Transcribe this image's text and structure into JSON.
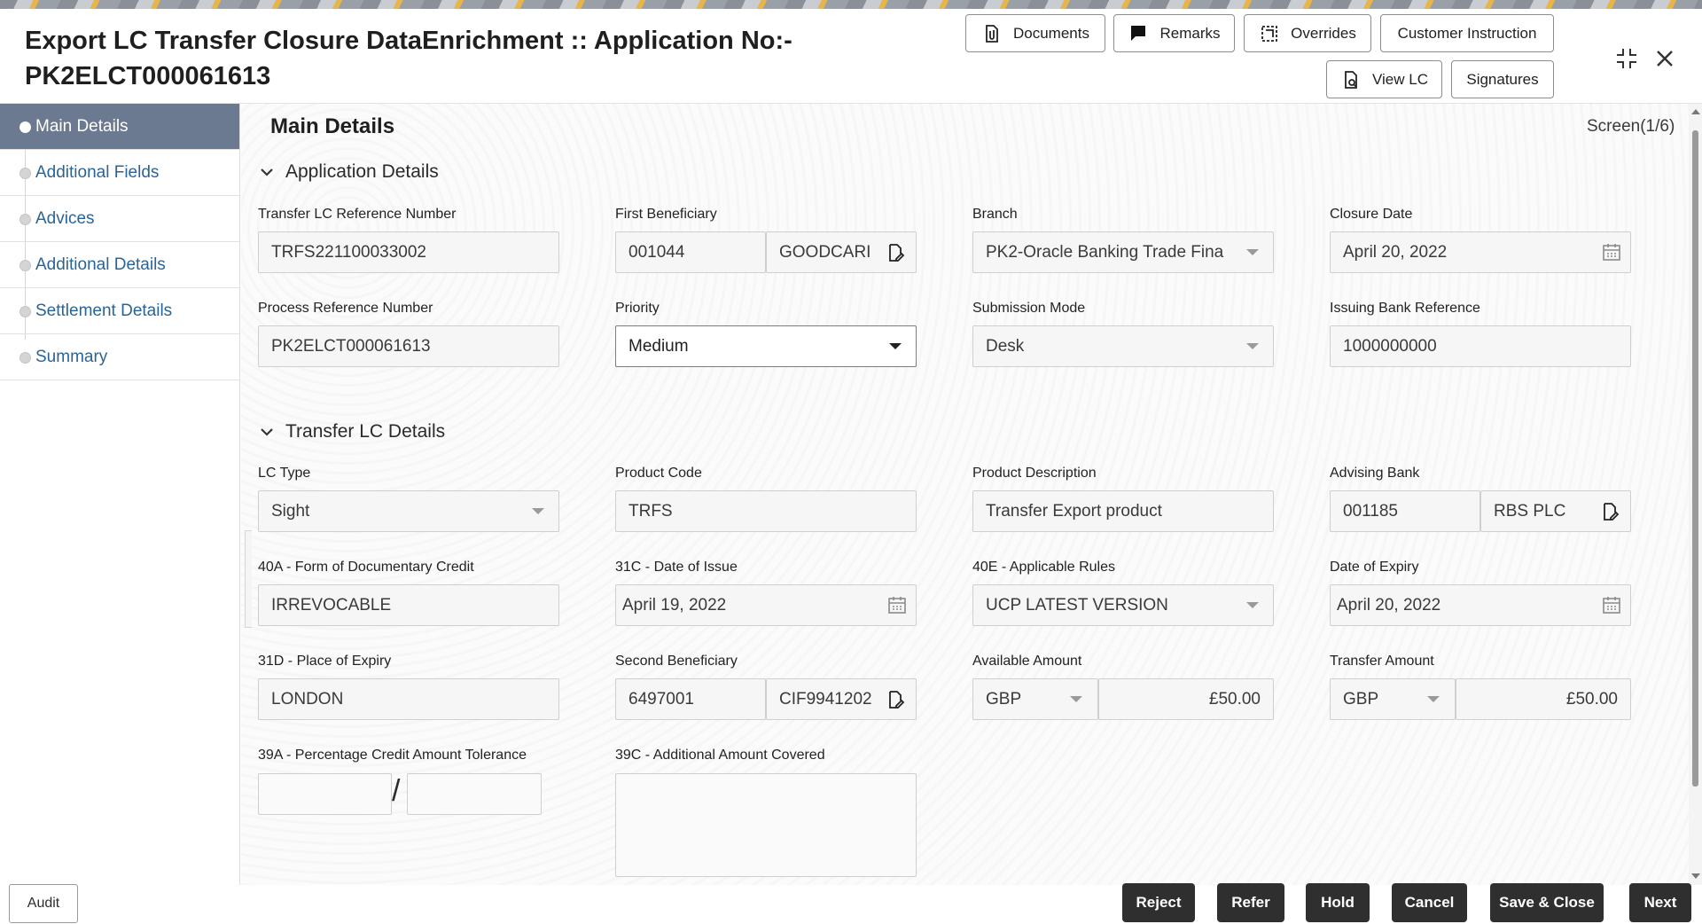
{
  "header": {
    "title": "Export LC Transfer Closure DataEnrichment :: Application No:- PK2ELCT000061613",
    "buttons": {
      "documents": "Documents",
      "remarks": "Remarks",
      "overrides": "Overrides",
      "customer_instruction": "Customer Instruction",
      "view_lc": "View LC",
      "signatures": "Signatures"
    }
  },
  "sidebar": {
    "items": [
      {
        "label": "Main Details"
      },
      {
        "label": "Additional Fields"
      },
      {
        "label": "Advices"
      },
      {
        "label": "Additional Details"
      },
      {
        "label": "Settlement Details"
      },
      {
        "label": "Summary"
      }
    ],
    "audit_label": "Audit"
  },
  "main": {
    "title": "Main Details",
    "screen": "Screen(1/6)",
    "application_details": {
      "heading": "Application Details",
      "transfer_lc_ref": {
        "label": "Transfer LC Reference Number",
        "value": "TRFS221100033002"
      },
      "first_beneficiary": {
        "label": "First Beneficiary",
        "id": "001044",
        "name": "GOODCARI"
      },
      "branch": {
        "label": "Branch",
        "value": "PK2-Oracle Banking Trade Fina"
      },
      "closure_date": {
        "label": "Closure Date",
        "value": "April 20, 2022"
      },
      "process_ref": {
        "label": "Process Reference Number",
        "value": "PK2ELCT000061613"
      },
      "priority": {
        "label": "Priority",
        "value": "Medium"
      },
      "submission_mode": {
        "label": "Submission Mode",
        "value": "Desk"
      },
      "issuing_bank_ref": {
        "label": "Issuing Bank Reference",
        "value": "1000000000"
      }
    },
    "transfer_lc_details": {
      "heading": "Transfer LC Details",
      "lc_type": {
        "label": "LC Type",
        "value": "Sight"
      },
      "product_code": {
        "label": "Product Code",
        "value": "TRFS"
      },
      "product_description": {
        "label": "Product Description",
        "value": "Transfer Export product"
      },
      "advising_bank": {
        "label": "Advising Bank",
        "id": "001185",
        "name": "RBS PLC"
      },
      "form_of_credit": {
        "label": "40A - Form of Documentary Credit",
        "value": "IRREVOCABLE"
      },
      "date_of_issue": {
        "label": "31C - Date of Issue",
        "value": "April 19, 2022"
      },
      "applicable_rules": {
        "label": "40E - Applicable Rules",
        "value": "UCP LATEST VERSION"
      },
      "date_of_expiry": {
        "label": "Date of Expiry",
        "value": "April 20, 2022"
      },
      "place_of_expiry": {
        "label": "31D - Place of Expiry",
        "value": "LONDON"
      },
      "second_beneficiary": {
        "label": "Second Beneficiary",
        "id": "6497001",
        "name": "CIF9941202"
      },
      "available_amount": {
        "label": "Available Amount",
        "currency": "GBP",
        "value": "£50.00"
      },
      "transfer_amount": {
        "label": "Transfer Amount",
        "currency": "GBP",
        "value": "£50.00"
      },
      "tolerance": {
        "label": "39A - Percentage Credit Amount Tolerance",
        "slash": "/"
      },
      "additional_amount": {
        "label": "39C - Additional Amount Covered"
      }
    }
  },
  "footer": {
    "reject": "Reject",
    "refer": "Refer",
    "hold": "Hold",
    "cancel": "Cancel",
    "save_close": "Save & Close",
    "next": "Next"
  }
}
